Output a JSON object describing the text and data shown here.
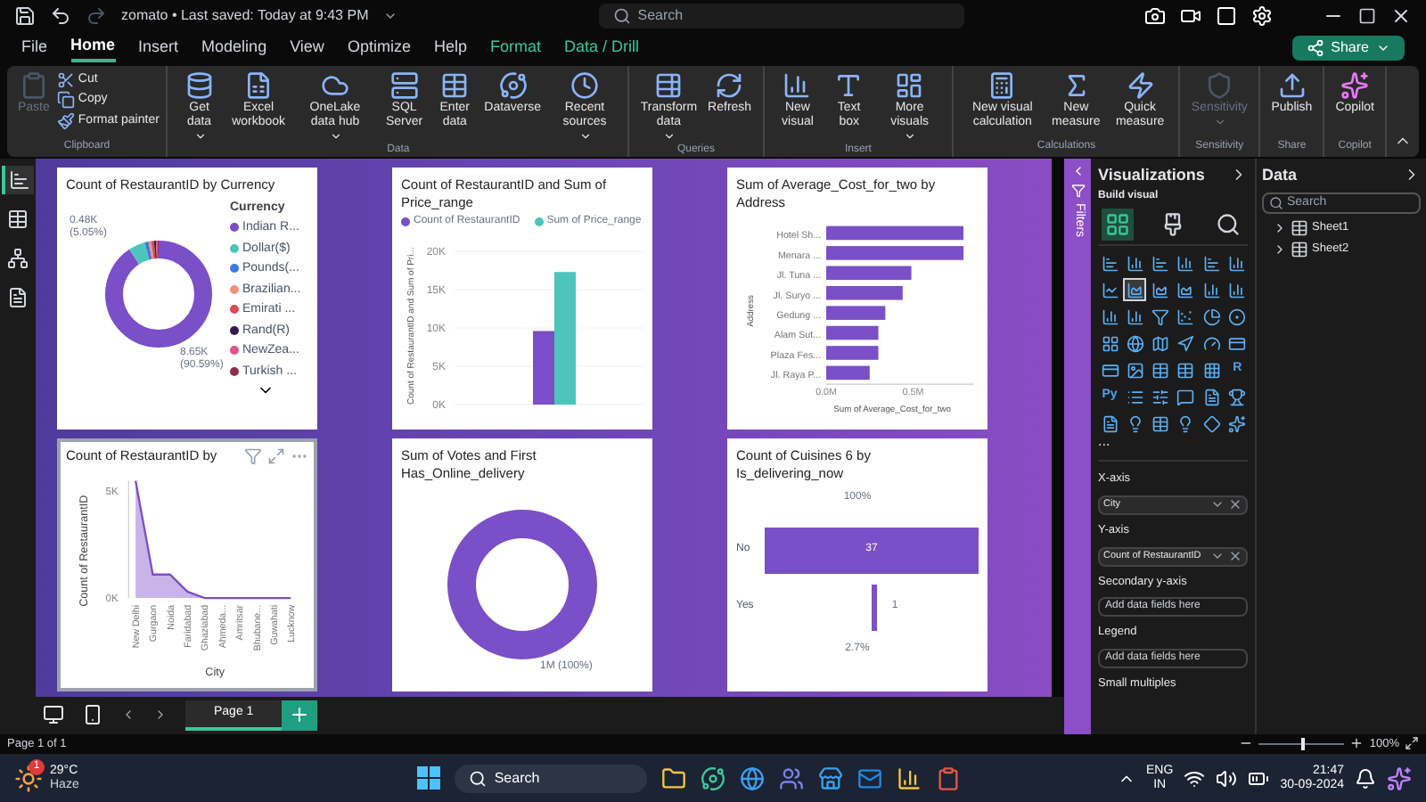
{
  "title_bar": {
    "title": "zomato • Last saved: Today at 9:43 PM",
    "search_placeholder": "Search"
  },
  "menu_tabs": [
    {
      "label": "File",
      "kind": "main",
      "selected": false
    },
    {
      "label": "Home",
      "kind": "main",
      "selected": true
    },
    {
      "label": "Insert",
      "kind": "main",
      "selected": false
    },
    {
      "label": "Modeling",
      "kind": "main",
      "selected": false
    },
    {
      "label": "View",
      "kind": "main",
      "selected": false
    },
    {
      "label": "Optimize",
      "kind": "main",
      "selected": false
    },
    {
      "label": "Help",
      "kind": "main",
      "selected": false
    },
    {
      "label": "Format",
      "kind": "contextual",
      "selected": false
    },
    {
      "label": "Data / Drill",
      "kind": "contextual",
      "selected": false
    }
  ],
  "share_button": "Share",
  "ribbon": {
    "groups": [
      {
        "label": "Clipboard",
        "items": [
          {
            "label": "Paste",
            "disabled": true,
            "dropdown": false
          }
        ],
        "small_items": [
          {
            "label": "Cut"
          },
          {
            "label": "Copy"
          },
          {
            "label": "Format painter"
          }
        ]
      },
      {
        "label": "Data",
        "items": [
          {
            "label": "Get data",
            "disabled": false,
            "dropdown": true
          },
          {
            "label": "Excel workbook",
            "disabled": false,
            "dropdown": false
          },
          {
            "label": "OneLake data hub",
            "disabled": false,
            "dropdown": true
          },
          {
            "label": "SQL Server",
            "disabled": false,
            "dropdown": false
          },
          {
            "label": "Enter data",
            "disabled": false,
            "dropdown": false
          },
          {
            "label": "Dataverse",
            "disabled": false,
            "dropdown": false
          },
          {
            "label": "Recent sources",
            "disabled": false,
            "dropdown": true
          }
        ]
      },
      {
        "label": "Queries",
        "items": [
          {
            "label": "Transform data",
            "disabled": false,
            "dropdown": true
          },
          {
            "label": "Refresh",
            "disabled": false,
            "dropdown": false
          }
        ]
      },
      {
        "label": "Insert",
        "items": [
          {
            "label": "New visual",
            "disabled": false,
            "dropdown": false
          },
          {
            "label": "Text box",
            "disabled": false,
            "dropdown": false
          },
          {
            "label": "More visuals",
            "disabled": false,
            "dropdown": true
          }
        ]
      },
      {
        "label": "Calculations",
        "items": [
          {
            "label": "New visual calculation",
            "disabled": false,
            "dropdown": false
          },
          {
            "label": "New measure",
            "disabled": false,
            "dropdown": false
          },
          {
            "label": "Quick measure",
            "disabled": false,
            "dropdown": false
          }
        ]
      },
      {
        "label": "Sensitivity",
        "items": [
          {
            "label": "Sensitivity",
            "disabled": true,
            "dropdown": true
          }
        ]
      },
      {
        "label": "Share",
        "items": [
          {
            "label": "Publish",
            "disabled": false,
            "dropdown": false
          }
        ]
      },
      {
        "label": "Copilot",
        "items": [
          {
            "label": "Copilot",
            "disabled": false,
            "dropdown": false
          }
        ]
      }
    ]
  },
  "view_rail": [
    {
      "selected": true
    },
    {
      "selected": false
    },
    {
      "selected": false
    },
    {
      "selected": false
    }
  ],
  "visuals": [
    {
      "kind": "currency_donut",
      "title": "Count of RestaurantID by Currency",
      "legend_title": "Currency",
      "legend": [
        {
          "label": "Indian R...",
          "color": "#7b4fc8"
        },
        {
          "label": "Dollar($)",
          "color": "#4fc4bd"
        },
        {
          "label": "Pounds(...",
          "color": "#3d7be0"
        },
        {
          "label": "Brazilian...",
          "color": "#f0947a"
        },
        {
          "label": "Emirati ...",
          "color": "#d9485a"
        },
        {
          "label": "Rand(R)",
          "color": "#3a1848"
        },
        {
          "label": "NewZea...",
          "color": "#e2528f"
        },
        {
          "label": "Turkish ...",
          "color": "#8e2f4f"
        }
      ],
      "labels": [
        "0.48K (5.05%)",
        "8.65K (90.59%)"
      ],
      "selected": false
    },
    {
      "kind": "column",
      "selected": false,
      "chart_data": {
        "type": "bar",
        "title": "Count of RestaurantID and Sum of Price_range",
        "ylabel": "Count of RestaurantID and Sum of Pri...",
        "series": [
          {
            "name": "Count of RestaurantID",
            "color": "#7b4fc8",
            "values": [
              9600
            ]
          },
          {
            "name": "Sum of Price_range",
            "color": "#4fc4bd",
            "values": [
              17300
            ]
          }
        ],
        "ylim": [
          0,
          20000
        ],
        "grid": true,
        "yticks": [
          {
            "value": 0,
            "label": "0K"
          },
          {
            "value": 5000,
            "label": "5K"
          },
          {
            "value": 10000,
            "label": "10K"
          },
          {
            "value": 15000,
            "label": "15K"
          },
          {
            "value": 20000,
            "label": "20K"
          }
        ]
      }
    },
    {
      "kind": "hbar",
      "selected": false,
      "chart_data": {
        "type": "bar",
        "orientation": "horizontal",
        "title": "Sum of Average_Cost_for_two by Address",
        "xlabel": "Sum of Average_Cost_for_two",
        "ylabel": "Address",
        "categories": [
          "Hotel Sh...",
          "Menara ...",
          "Jl. Tuna ...",
          "Jl. Suryo ...",
          "Gedung ...",
          "Alam Sut...",
          "Plaza Fes...",
          "Jl. Raya P..."
        ],
        "series": [
          {
            "color": "#7b4fc8",
            "values": [
              0.79,
              0.79,
              0.49,
              0.44,
              0.34,
              0.3,
              0.3,
              0.25
            ]
          }
        ],
        "xlim": [
          0,
          0.85
        ],
        "xticks": [
          {
            "value": 0,
            "label": "0.0M"
          },
          {
            "value": 0.5,
            "label": "0.5M"
          }
        ]
      }
    },
    {
      "kind": "area",
      "selected": true,
      "chart_data": {
        "type": "area",
        "title": "Count of RestaurantID by",
        "xlabel": "City",
        "ylabel": "Count of RestaurantID",
        "categories": [
          "New Delhi",
          "Gurgaon",
          "Noida",
          "Faridabad",
          "Ghaziabad",
          "Ahmeda...",
          "Amritsar",
          "Bhubane...",
          "Guwahati",
          "Lucknow"
        ],
        "series": [
          {
            "color": "#7b4fc8",
            "values": [
              5500,
              1100,
              1100,
              300,
              0,
              0,
              0,
              0,
              0,
              0
            ]
          }
        ],
        "ylim": [
          0,
          5500
        ],
        "yticks": [
          {
            "value": 0,
            "label": "0K"
          },
          {
            "value": 5000,
            "label": "5K"
          }
        ]
      }
    },
    {
      "kind": "donut",
      "selected": false,
      "title": "Sum of Votes and First Has_Online_delivery",
      "label": "1M (100%)"
    },
    {
      "kind": "funnel",
      "selected": false,
      "title": "Count of Cuisines 6 by Is_delivering_now",
      "top_label": "100%",
      "bottom_label": "2.7%",
      "stages": [
        {
          "category": "No",
          "value": "37"
        },
        {
          "category": "Yes",
          "value": "1"
        }
      ]
    }
  ],
  "filters_label": "Filters",
  "visualizations": {
    "title": "Visualizations",
    "subtitle": "Build visual",
    "build_tabs": [
      {
        "selected": true
      },
      {
        "selected": false
      },
      {
        "selected": false
      }
    ],
    "gallery": [
      {
        "kind": "bar",
        "selected": false
      },
      {
        "kind": "column",
        "selected": false
      },
      {
        "kind": "bar",
        "selected": false
      },
      {
        "kind": "column",
        "selected": false
      },
      {
        "kind": "bar",
        "selected": false
      },
      {
        "kind": "column",
        "selected": false
      },
      {
        "kind": "line",
        "selected": false
      },
      {
        "kind": "area",
        "selected": true
      },
      {
        "kind": "area",
        "selected": false
      },
      {
        "kind": "area",
        "selected": false
      },
      {
        "kind": "column",
        "selected": false
      },
      {
        "kind": "column",
        "selected": false
      },
      {
        "kind": "column",
        "selected": false
      },
      {
        "kind": "column",
        "selected": false
      },
      {
        "kind": "funnel",
        "selected": false
      },
      {
        "kind": "scatter",
        "selected": false
      },
      {
        "kind": "pie",
        "selected": false
      },
      {
        "kind": "donut",
        "selected": false
      },
      {
        "kind": "treemap",
        "selected": false
      },
      {
        "kind": "globe",
        "selected": false
      },
      {
        "kind": "map",
        "selected": false
      },
      {
        "kind": "navigation",
        "selected": false
      },
      {
        "kind": "gauge",
        "selected": false
      },
      {
        "kind": "card",
        "selected": false
      },
      {
        "kind": "card",
        "selected": false
      },
      {
        "kind": "image",
        "selected": false
      },
      {
        "kind": "table",
        "selected": false
      },
      {
        "kind": "table",
        "selected": false
      },
      {
        "kind": "matrix",
        "selected": false
      },
      {
        "kind": "script",
        "label": "R",
        "selected": false
      },
      {
        "kind": "script",
        "label": "Py",
        "selected": false
      },
      {
        "kind": "list",
        "selected": false
      },
      {
        "kind": "slicer",
        "selected": false
      },
      {
        "kind": "message",
        "selected": false
      },
      {
        "kind": "file",
        "selected": false
      },
      {
        "kind": "trophy",
        "selected": false
      },
      {
        "kind": "file",
        "selected": false
      },
      {
        "kind": "lightbulb",
        "selected": false
      },
      {
        "kind": "table",
        "selected": false
      },
      {
        "kind": "lightbulb",
        "selected": false
      },
      {
        "kind": "diamond",
        "selected": false
      },
      {
        "kind": "sparkles",
        "selected": false
      }
    ],
    "more": "...",
    "wells": [
      {
        "label": "X-axis",
        "field": "City"
      },
      {
        "label": "Y-axis",
        "field": "Count of RestaurantID"
      },
      {
        "label": "Secondary y-axis",
        "placeholder": "Add data fields here"
      },
      {
        "label": "Legend",
        "placeholder": "Add data fields here"
      },
      {
        "label": "Small multiples"
      }
    ]
  },
  "data_pane": {
    "title": "Data",
    "search_placeholder": "Search",
    "tables": [
      {
        "label": "Sheet1",
        "expanded": false
      },
      {
        "label": "Sheet2",
        "expanded": false
      }
    ]
  },
  "pages": [
    {
      "label": "Page 1",
      "selected": true
    }
  ],
  "status_bar": {
    "page_info": "Page 1 of 1",
    "zoom": {
      "level": 0.5
    },
    "zoom_text": "100%"
  },
  "taskbar": {
    "weather_badge": "1",
    "temperature": "29°C",
    "condition": "Haze",
    "search_placeholder": "Search",
    "language": "ENG",
    "region": "IN",
    "time": "21:47",
    "date": "30-09-2024"
  }
}
